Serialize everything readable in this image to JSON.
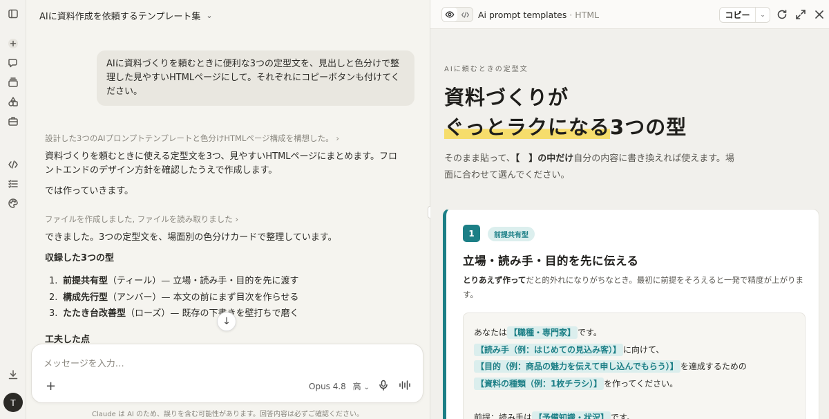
{
  "rail": {
    "icons": [
      "sidebar-toggle-icon",
      "new-chat-icon",
      "chats-icon",
      "projects-icon",
      "artifacts-icon",
      "tools-icon",
      "code-icon",
      "tasks-icon",
      "palette-icon",
      "download-icon"
    ],
    "avatar_initial": "T"
  },
  "chat": {
    "title": "AIに資料作成を依頼するテンプレート集",
    "user_message": "AIに資料づくりを頼むときに便利な3つの定型文を、見出しと色分けで整理した見やすいHTMLページにして。それぞれにコピーボタンも付けてください。",
    "thought_1": "設計した3つのAIプロンプトテンプレートと色分けHTMLページ構成を構想した。",
    "reply_1": "資料づくりを頼むときに使える定型文を3つ、見やすいHTMLページにまとめます。フロントエンドのデザイン方針を確認したうえで作成します。",
    "reply_2": "では作っていきます。",
    "thought_2": "ファイルを作成しました, ファイルを読み取りました",
    "reply_3": "できました。3つの定型文を、場面別の色分けカードで整理しています。",
    "section_heading": "収録した3つの型",
    "list": [
      {
        "num": "1.",
        "bold": "前提共有型",
        "rest": "（ティール）— 立場・読み手・目的を先に渡す"
      },
      {
        "num": "2.",
        "bold": "構成先行型",
        "rest": "（アンバー）— 本文の前にまず目次を作らせる"
      },
      {
        "num": "3.",
        "bold": "たたき台改善型",
        "rest": "（ローズ）— 既存の下書きを壁打ちで磨く"
      }
    ],
    "section_heading_2": "工夫した点",
    "composer_placeholder": "メッセージを入力…",
    "model_label": "Opus 4.8",
    "effort_label": "高",
    "disclaimer": "Claude は AI のため、誤りを含む可能性があります。回答内容は必ずご確認ください。"
  },
  "preview": {
    "title": "Ai prompt templates",
    "type": "· HTML",
    "copy_label": "コピー",
    "eyebrow": "AIに頼むときの定型文",
    "headline_line1": "資料づくりが",
    "headline_hl": "ぐっとラクになる",
    "headline_rest": "3つの型",
    "lead_1": "そのまま貼って、",
    "lead_bold": "【　】の中だけ",
    "lead_2": "自分の内容に書き換えれば使えます。場面に合わせて選んでください。",
    "card": {
      "number": "1",
      "tag": "前提共有型",
      "title": "立場・読み手・目的を先に伝える",
      "desc_bold": "とりあえず作って",
      "desc_rest": "だと的外れになりがちなとき。最初に前提をそろえると一発で精度が上がります。",
      "template": [
        {
          "pre": "あなたは",
          "chip": "【職種・専門家】",
          "post": "です。"
        },
        {
          "pre": "",
          "chip": "【読み手（例：はじめての見込み客）】",
          "post": "に向けて、"
        },
        {
          "pre": "",
          "chip": "【目的（例：商品の魅力を伝えて申し込んでもらう）】",
          "post": "を達成するための"
        },
        {
          "pre": "",
          "chip": "【資料の種類（例：1枚チラシ）】",
          "post": "を作ってください。"
        },
        {
          "pre": "",
          "chip": "",
          "post": ""
        },
        {
          "pre": "前提：読み手は",
          "chip": "【予備知識・状況】",
          "post": "です。"
        }
      ]
    }
  }
}
